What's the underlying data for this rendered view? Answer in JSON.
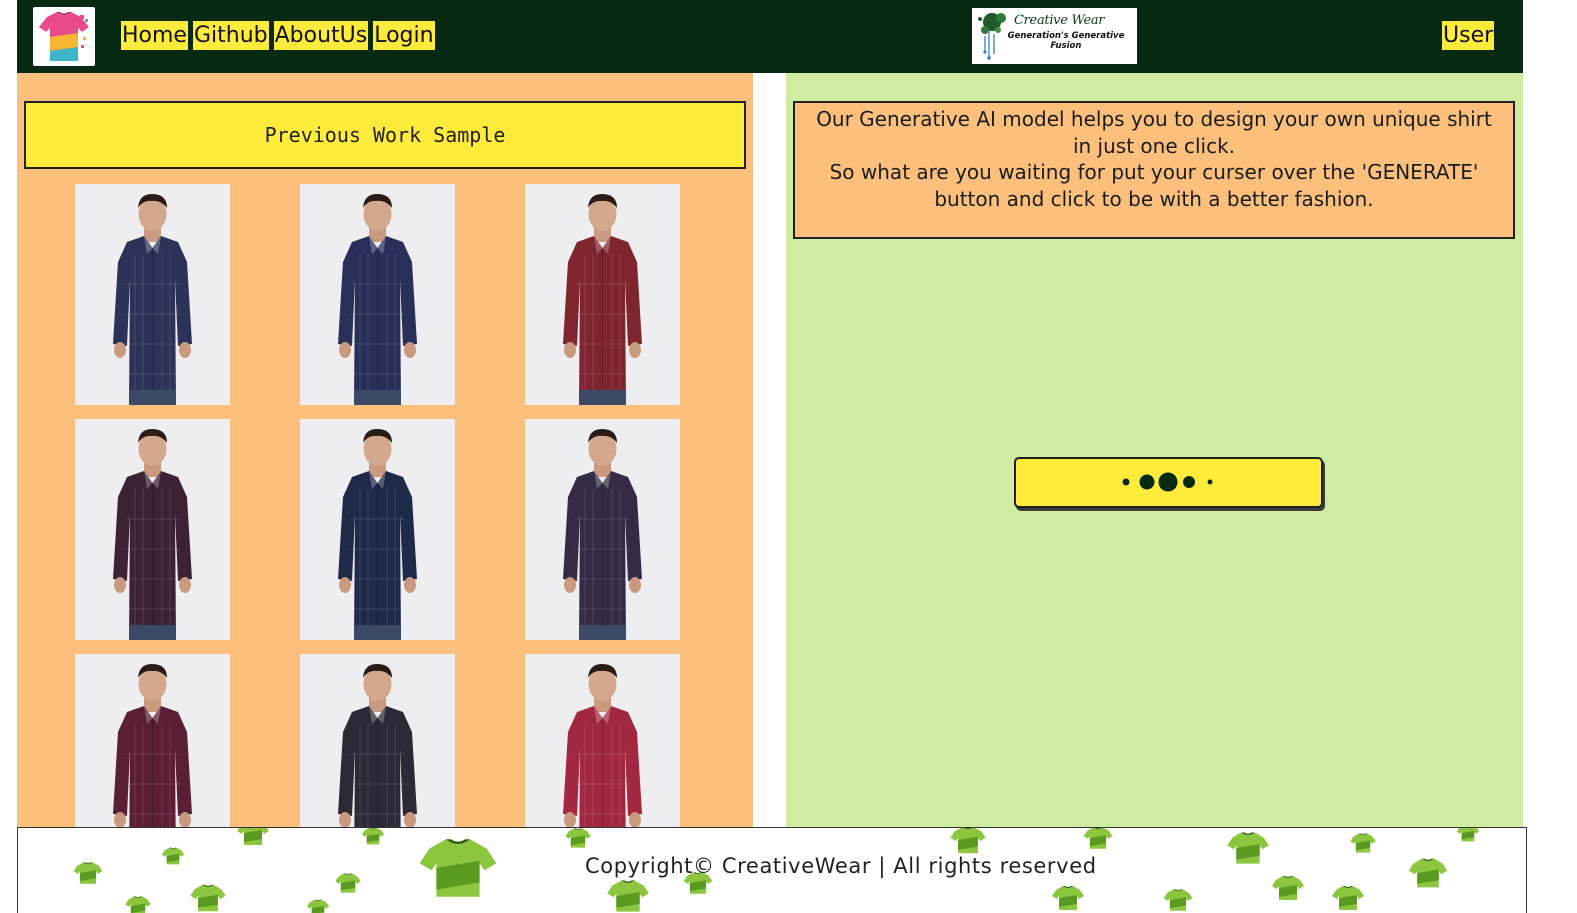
{
  "nav": {
    "links": [
      "Home",
      "Github",
      "AboutUs",
      "Login"
    ],
    "user_label": "User",
    "bg_color": "#082a12",
    "link_color": "#ffeb3b"
  },
  "brand": {
    "title": "Creative Wear",
    "tagline": "Generation's Generative Fusion",
    "logo_icon": "shirt-logo-icon",
    "brand_icon": "paint-splash-icon"
  },
  "gallery": {
    "heading": "Previous Work Sample",
    "items": [
      {
        "alt": "Man in navy checked shirt",
        "shirt_color": "#2d3358"
      },
      {
        "alt": "Man in dark blue patterned shirt",
        "shirt_color": "#28305a"
      },
      {
        "alt": "Man in maroon checked shirt",
        "shirt_color": "#7e2530"
      },
      {
        "alt": "Man in dark burgundy shirt",
        "shirt_color": "#3d2236"
      },
      {
        "alt": "Man in dark floral print shirt",
        "shirt_color": "#1f2a4a"
      },
      {
        "alt": "Man in dark plaid shirt",
        "shirt_color": "#352b45"
      },
      {
        "alt": "Man in burgundy half-sleeve shirt",
        "shirt_color": "#5a1f36"
      },
      {
        "alt": "Man in dark printed shirt",
        "shirt_color": "#2c2a36"
      },
      {
        "alt": "Man in red shirt",
        "shirt_color": "#a12840"
      }
    ],
    "bg_color": "#fcc07c"
  },
  "generator": {
    "description": [
      "Our Generative AI model helps you to design your own unique shirt",
      "in just one click.",
      "So what are you waiting for put your curser over the 'GENERATE'",
      "button and click to be with a better fashion."
    ],
    "button_state": "loading",
    "button_icon": "loading-dots-icon",
    "bg_color": "#d0eca0"
  },
  "footer": {
    "copyright": "Copyright© CreativeWear | All rights reserved",
    "pattern_icon": "ai-shirt-pattern-icon"
  }
}
